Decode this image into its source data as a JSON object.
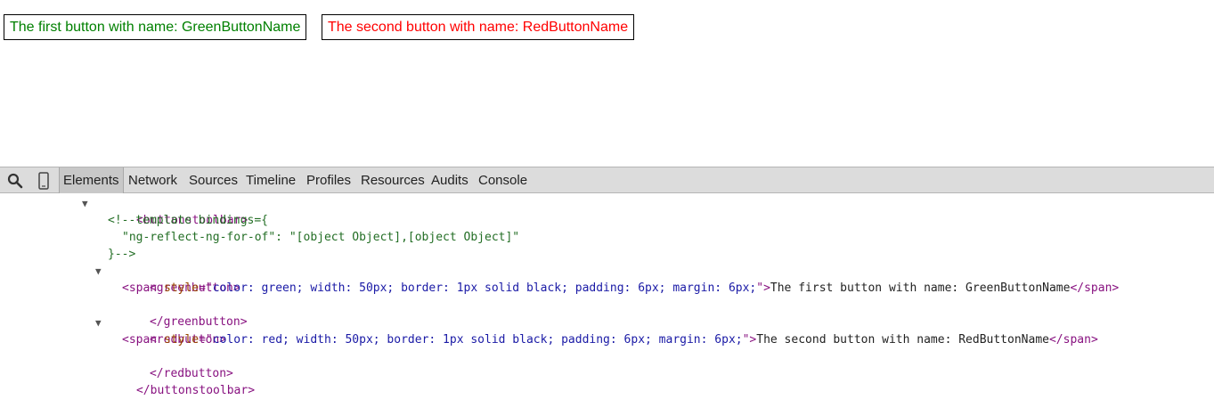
{
  "page": {
    "green_button_text": "The first button with name: GreenButtonName",
    "red_button_text": "The second button with name: RedButtonName",
    "green_color": "#008000",
    "red_color": "#ff0000"
  },
  "devtools": {
    "icons": [
      "search-icon",
      "device-mode-icon"
    ],
    "tabs": [
      "Elements",
      "Network",
      "Sources",
      "Timeline",
      "Profiles",
      "Resources",
      "Audits",
      "Console"
    ],
    "active_tab": "Elements"
  },
  "dom_tree": {
    "buttonstoolbar_open": "<buttonstoolbar>",
    "comment_1": "<!--template bindings={",
    "comment_2": "\"ng-reflect-ng-for-of\": \"[object Object],[object Object]\"",
    "comment_3": "}-->",
    "greenbutton_open": "<greenbutton>",
    "span_open": "<span ",
    "style_attr": "style",
    "equals_quote": "=\"",
    "green_style_value": "color: green; width: 50px; border: 1px solid black; padding: 6px; margin: 6px;",
    "quote_close": "\">",
    "green_text": "The first button with name: GreenButtonName",
    "span_close": "</span>",
    "greenbutton_close": "</greenbutton>",
    "redbutton_open": "<redbutton>",
    "red_style_value": "color: red; width: 50px; border: 1px solid black; padding: 6px; margin: 6px;",
    "red_text": "The second button with name: RedButtonName",
    "redbutton_close": "</redbutton>",
    "buttonstoolbar_close": "</buttonstoolbar>",
    "expand_arrow": "▼"
  }
}
